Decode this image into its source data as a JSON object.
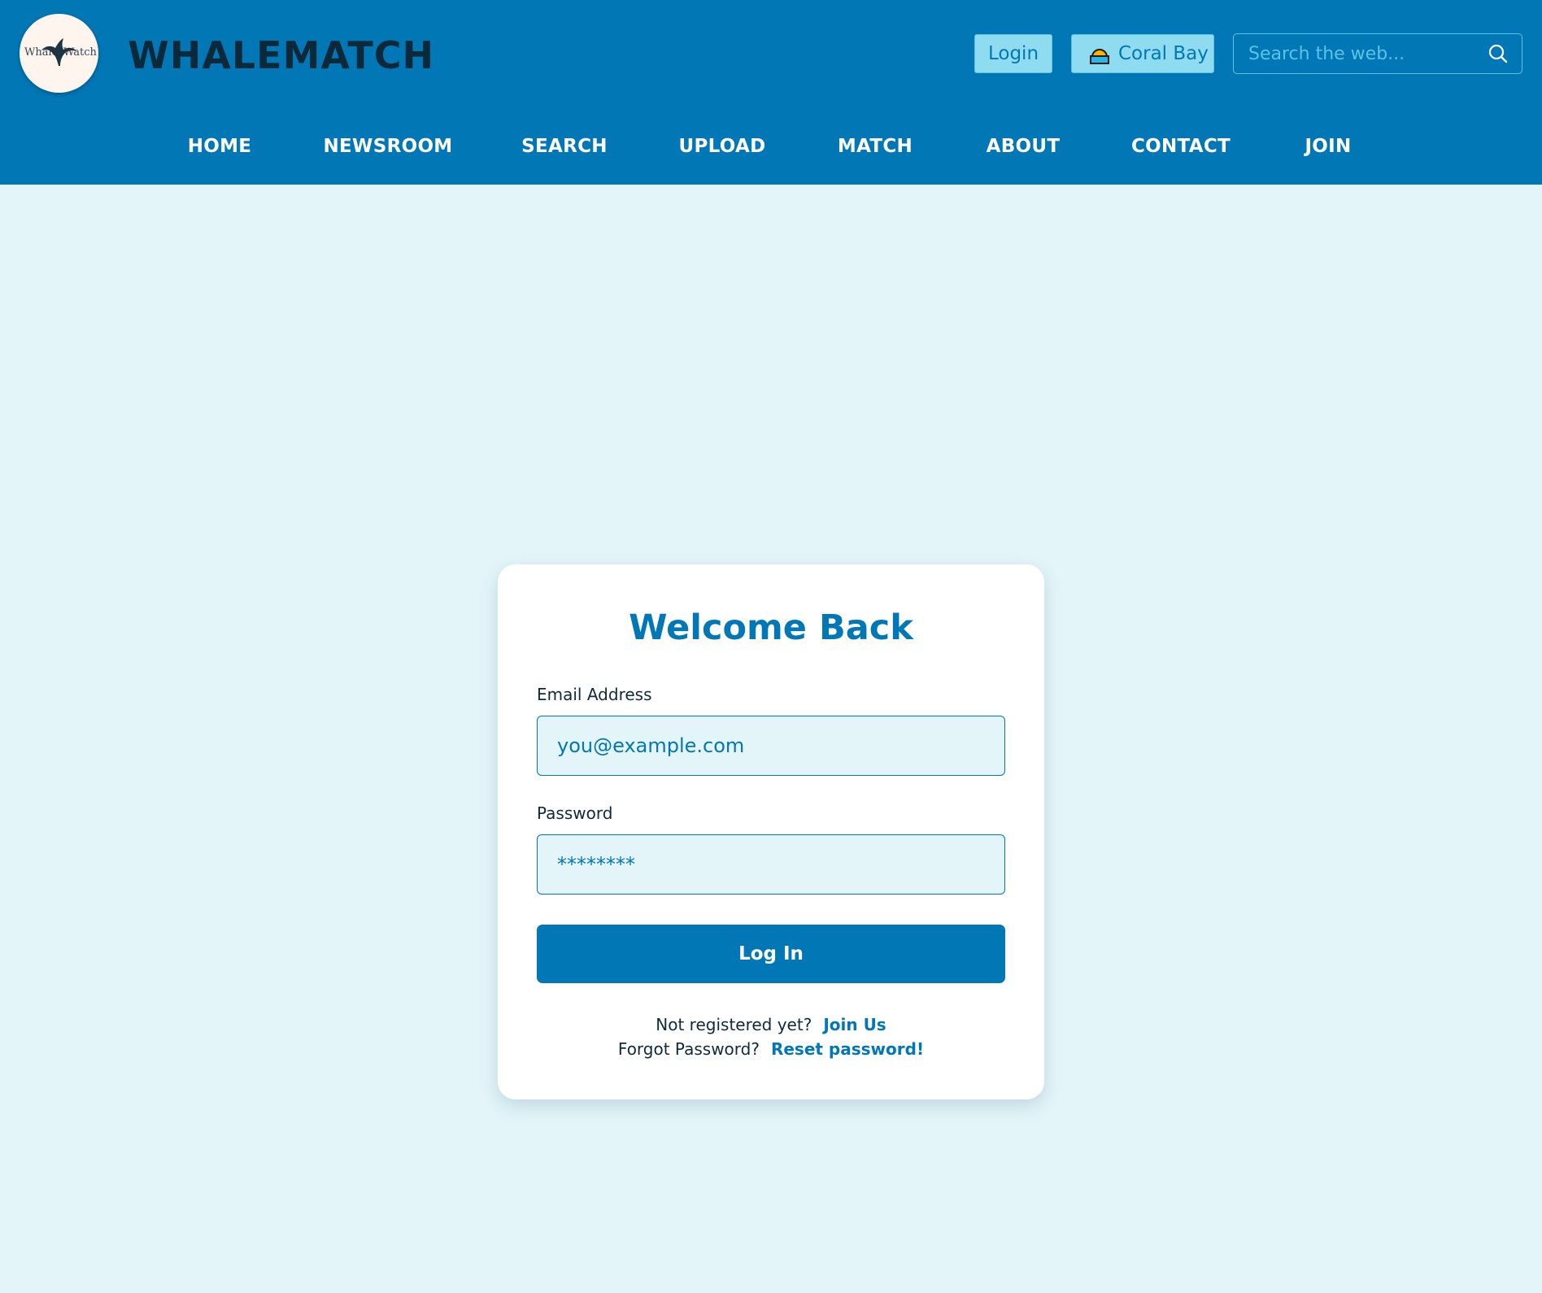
{
  "header": {
    "logo": {
      "word_left": "Whale",
      "word_right": "Watch",
      "icon": "whale-tail-icon"
    },
    "brand": "WHALEMATCH",
    "login_label": "Login",
    "location": {
      "label": "Coral Bay",
      "icon": "beach-sun-icon"
    },
    "search": {
      "placeholder": "Search the web...",
      "icon": "search-icon"
    }
  },
  "nav": {
    "items": [
      {
        "label": "HOME"
      },
      {
        "label": "NEWSROOM"
      },
      {
        "label": "SEARCH"
      },
      {
        "label": "UPLOAD"
      },
      {
        "label": "MATCH"
      },
      {
        "label": "ABOUT"
      },
      {
        "label": "CONTACT"
      },
      {
        "label": "JOIN"
      }
    ]
  },
  "login_card": {
    "title": "Welcome Back",
    "email": {
      "label": "Email Address",
      "placeholder": "you@example.com"
    },
    "password": {
      "label": "Password",
      "placeholder": "********"
    },
    "submit_label": "Log In",
    "register_text": "Not registered yet?",
    "register_link": "Join Us",
    "forgot_text": "Forgot Password?",
    "forgot_link": "Reset password!"
  },
  "colors": {
    "header_bg": "#0277b6",
    "page_bg": "#e3f5f9",
    "accent": "#0277b6",
    "button_light": "#8fdcf1",
    "brand_text": "#0a2a3c"
  }
}
